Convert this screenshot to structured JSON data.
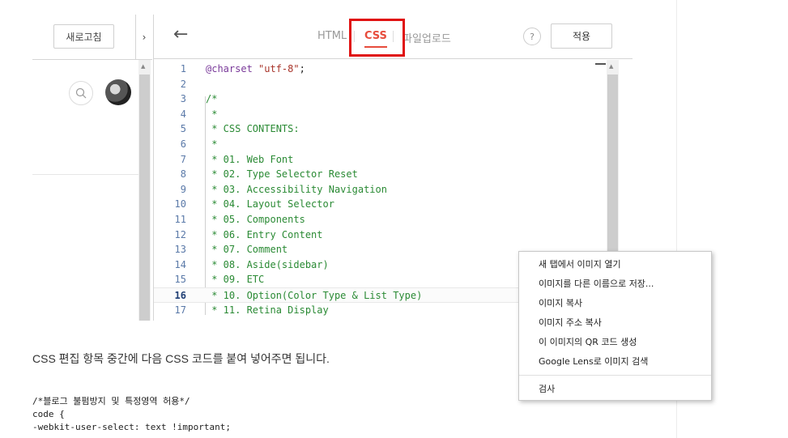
{
  "left_panel": {
    "refresh_label": "새로고침",
    "collapse_glyph": "›"
  },
  "editor": {
    "tabs": [
      {
        "label": "HTML"
      },
      {
        "label": "CSS",
        "active": true
      },
      {
        "label": "파일업로드"
      }
    ],
    "help_label": "?",
    "apply_label": "적용",
    "active_line": 16,
    "lines": [
      {
        "n": "1",
        "text": "@charset \"utf-8\";"
      },
      {
        "n": "2",
        "text": ""
      },
      {
        "n": "3",
        "text": "/*"
      },
      {
        "n": "4",
        "text": " *"
      },
      {
        "n": "5",
        "text": " * CSS CONTENTS:"
      },
      {
        "n": "6",
        "text": " *"
      },
      {
        "n": "7",
        "text": " * 01. Web Font"
      },
      {
        "n": "8",
        "text": " * 02. Type Selector Reset"
      },
      {
        "n": "9",
        "text": " * 03. Accessibility Navigation"
      },
      {
        "n": "10",
        "text": " * 04. Layout Selector"
      },
      {
        "n": "11",
        "text": " * 05. Components"
      },
      {
        "n": "12",
        "text": " * 06. Entry Content"
      },
      {
        "n": "13",
        "text": " * 07. Comment"
      },
      {
        "n": "14",
        "text": " * 08. Aside(sidebar)"
      },
      {
        "n": "15",
        "text": " * 09. ETC"
      },
      {
        "n": "16",
        "text": " * 10. Option(Color Type & List Type)"
      },
      {
        "n": "17",
        "text": " * 11. Retina Display"
      }
    ]
  },
  "blog": {
    "instruction": "CSS 편집 항목 중간에 다음 CSS 코드를 붙여 넣어주면 됩니다.",
    "snippet": "/*블로그 불펌방지 및 특정영역 허용*/\ncode {\n-webkit-user-select: text !important;"
  },
  "context_menu": {
    "items": [
      "새 탭에서 이미지 열기",
      "이미지를 다른 이름으로 저장...",
      "이미지 복사",
      "이미지 주소 복사",
      "이 이미지의 QR 코드 생성",
      "Google Lens로 이미지 검색"
    ],
    "inspect": "검사"
  },
  "colors": {
    "accent": "#e74c3c",
    "highlight_box": "#e01010",
    "comment": "#2a8a34",
    "at_rule": "#7a3a9a",
    "string": "#a8342a",
    "line_number": "#5a79a8"
  },
  "icons": [
    "search-icon",
    "back-arrow-icon",
    "help-icon",
    "chevron-right-icon"
  ]
}
